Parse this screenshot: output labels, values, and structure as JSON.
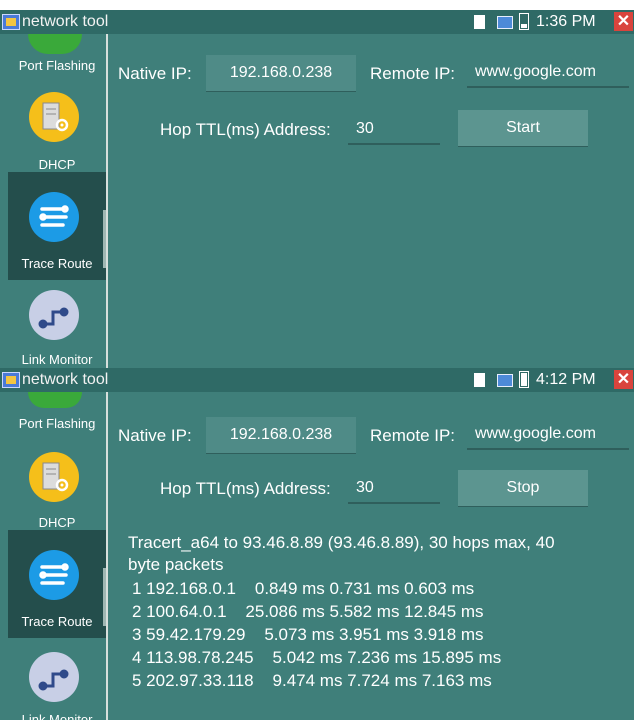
{
  "screens": [
    {
      "status": {
        "app_title": "network tool",
        "time": "1:36 PM",
        "battery_level": 0.25
      },
      "sidebar": {
        "items": [
          "Port Flashing",
          "DHCP",
          "Trace Route",
          "Link Monitor"
        ],
        "selected": "Trace Route"
      },
      "form": {
        "native_ip_label": "Native IP:",
        "native_ip_value": "192.168.0.238",
        "remote_ip_label": "Remote IP:",
        "remote_ip_value": "www.google.com",
        "hop_label": "Hop TTL(ms) Address:",
        "hop_value": "30",
        "action_button": "Start"
      },
      "results": []
    },
    {
      "status": {
        "app_title": "network tool",
        "time": "4:12 PM",
        "battery_level": 0.85
      },
      "sidebar": {
        "items": [
          "Port Flashing",
          "DHCP",
          "Trace Route",
          "Link Monitor"
        ],
        "selected": "Trace Route"
      },
      "form": {
        "native_ip_label": "Native IP:",
        "native_ip_value": "192.168.0.238",
        "remote_ip_label": "Remote IP:",
        "remote_ip_value": "www.google.com",
        "hop_label": "Hop TTL(ms) Address:",
        "hop_value": "30",
        "action_button": "Stop"
      },
      "results": [
        "Tracert_a64 to 93.46.8.89 (93.46.8.89), 30 hops max, 40",
        "byte packets",
        "1 192.168.0.1    0.849 ms 0.731 ms 0.603 ms",
        "2 100.64.0.1    25.086 ms 5.582 ms 12.845 ms",
        "3 59.42.179.29    5.073 ms 3.951 ms 3.918 ms",
        "4 113.98.78.245    5.042 ms 7.236 ms 15.895 ms",
        "5 202.97.33.118    9.474 ms 7.724 ms 7.163 ms"
      ]
    }
  ],
  "colors": {
    "background": "#3f7f7a",
    "statusbar": "#2f6a66",
    "sidebar_selected": "#244e4c",
    "dhcp_icon": "#f5bf1a",
    "trace_icon": "#1c9be6",
    "link_icon": "#c8cfe6"
  },
  "icons": {
    "dhcp": "server-gear-icon",
    "trace_route": "route-lines-icon",
    "link_monitor": "link-path-icon"
  }
}
